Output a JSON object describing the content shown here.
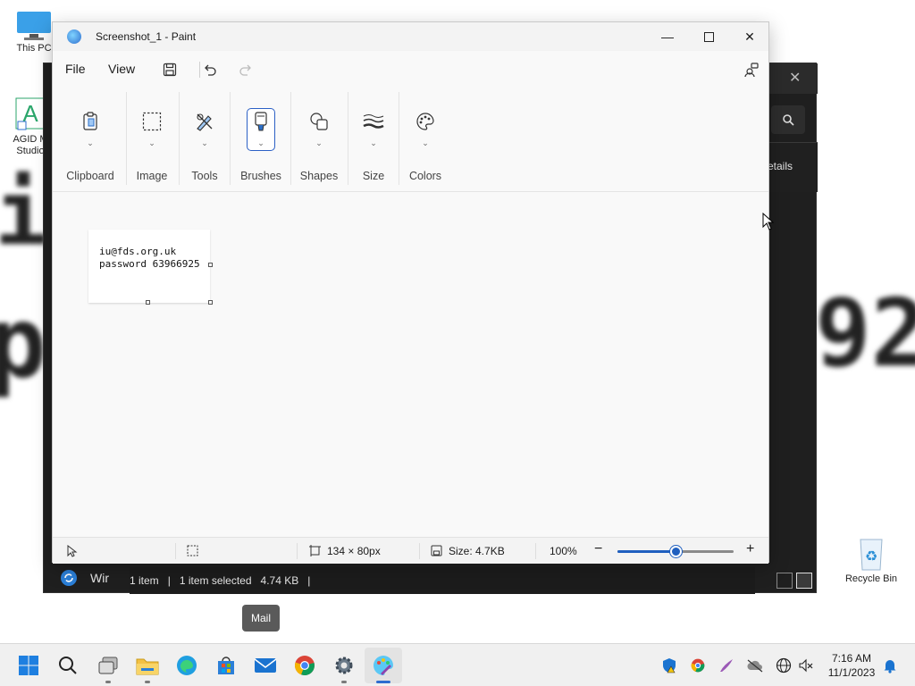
{
  "desktop": {
    "bg_letters": {
      "left_top": "i",
      "left_bottom": "p",
      "right_bottom": "92"
    },
    "icons": [
      {
        "label": "This PC",
        "name": "this-pc"
      },
      {
        "label": "AGID M Studio",
        "name": "agid-studio"
      },
      {
        "label": "Recycle Bin",
        "name": "recycle-bin"
      }
    ]
  },
  "explorer": {
    "details_label": "etails",
    "sidebar_label": "Wir",
    "status": {
      "items": "1 item",
      "selected": "1 item selected",
      "size": "4.74 KB",
      "sep": "|"
    }
  },
  "paint": {
    "title": "Screenshot_1 - Paint",
    "menu": {
      "file": "File",
      "view": "View"
    },
    "ribbon": [
      {
        "label": "Clipboard",
        "name": "clipboard"
      },
      {
        "label": "Image",
        "name": "image"
      },
      {
        "label": "Tools",
        "name": "tools"
      },
      {
        "label": "Brushes",
        "name": "brushes"
      },
      {
        "label": "Shapes",
        "name": "shapes"
      },
      {
        "label": "Size",
        "name": "size"
      },
      {
        "label": "Colors",
        "name": "colors"
      }
    ],
    "canvas_text": {
      "line1": "iu@fds.org.uk",
      "line2": "password 63966925"
    },
    "status": {
      "dimensions": "134 × 80px",
      "size": "Size: 4.7KB",
      "zoom": "100%",
      "zoom_level": 0.5
    }
  },
  "tooltip": {
    "text": "Mail"
  },
  "taskbar": {
    "time": "7:16 AM",
    "date": "11/1/2023",
    "apps": [
      "start",
      "search",
      "task-view",
      "file-explorer",
      "edge",
      "store",
      "mail",
      "chrome",
      "settings",
      "paint"
    ]
  },
  "colors": {
    "accent": "#1f5fbf",
    "selection": "#2c60c5"
  }
}
